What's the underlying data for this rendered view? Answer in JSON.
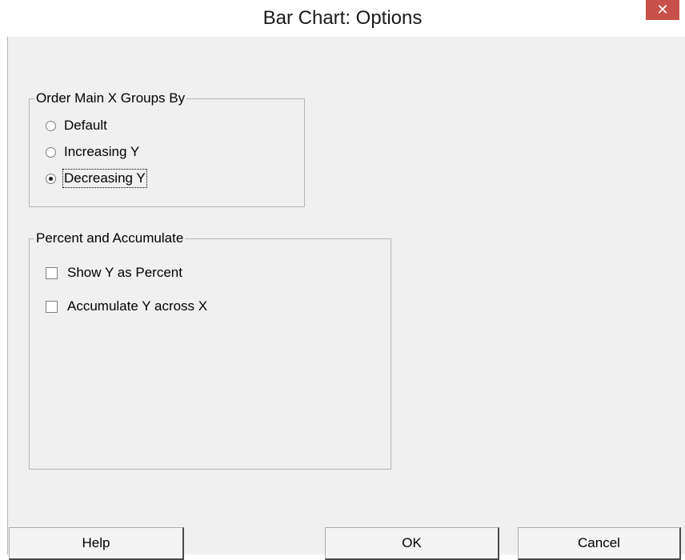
{
  "window": {
    "title": "Bar Chart: Options",
    "close_glyph": "✕"
  },
  "order_group": {
    "label": "Order Main X Groups By",
    "options": [
      {
        "label": "Default",
        "checked": false
      },
      {
        "label": "Increasing Y",
        "checked": false
      },
      {
        "label": "Decreasing Y",
        "checked": true
      }
    ]
  },
  "percent_group": {
    "label": "Percent and Accumulate",
    "options": [
      {
        "label": "Show Y as Percent",
        "checked": false
      },
      {
        "label": "Accumulate Y across X",
        "checked": false
      }
    ]
  },
  "buttons": {
    "help": "Help",
    "ok": "OK",
    "cancel": "Cancel"
  },
  "colors": {
    "close_button": "#c7504a",
    "dialog_background": "#f0f0f0"
  }
}
